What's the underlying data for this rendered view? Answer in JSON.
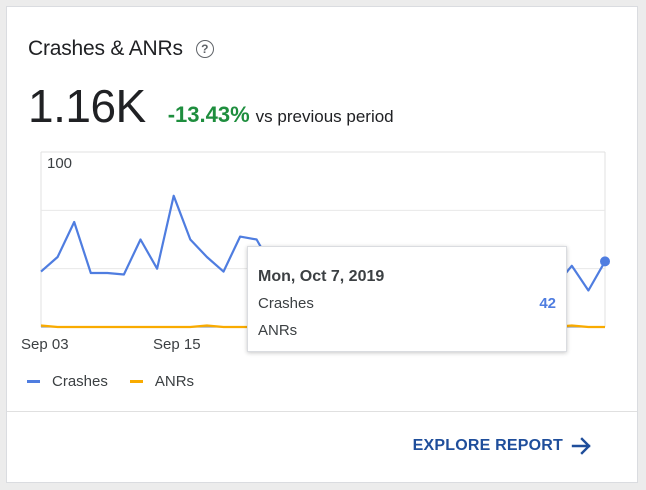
{
  "card": {
    "title": "Crashes & ANRs",
    "help_icon": "help-circle-icon",
    "value": "1.16K",
    "delta": "-13.43%",
    "delta_suffix": "vs previous period",
    "delta_color": "#1e8e3e"
  },
  "chart_data": {
    "type": "line",
    "y_tick_labels": [
      "100"
    ],
    "ylim": [
      0,
      120
    ],
    "x_tick_labels": [
      "Sep 03",
      "Sep 15"
    ],
    "grid": true,
    "series": [
      {
        "name": "Crashes",
        "color": "#4f7de0",
        "values": [
          38,
          48,
          72,
          37,
          37,
          36,
          60,
          40,
          90,
          60,
          48,
          38,
          62,
          60,
          40,
          30,
          30,
          30,
          30,
          30,
          28,
          40,
          30,
          28,
          30,
          30,
          40,
          30,
          42,
          40,
          30,
          28,
          42,
          25,
          45
        ]
      },
      {
        "name": "ANRs",
        "color": "#f9ab00",
        "values": [
          1,
          0,
          0,
          0,
          0,
          0,
          0,
          0,
          0,
          0,
          1,
          0,
          0,
          0,
          0,
          0,
          0,
          0,
          0,
          0,
          0,
          0,
          0,
          0,
          0,
          0,
          0,
          0,
          0,
          0,
          0,
          0,
          1,
          0,
          0
        ]
      }
    ]
  },
  "tooltip": {
    "date": "Mon, Oct 7, 2019",
    "crashes_label": "Crashes",
    "crashes_value": "42",
    "anrs_label": "ANRs"
  },
  "legend": [
    {
      "label": "Crashes",
      "color": "#4f7de0"
    },
    {
      "label": "ANRs",
      "color": "#f9ab00"
    }
  ],
  "footer": {
    "explore_label": "EXPLORE REPORT",
    "explore_icon": "arrow-right-icon"
  }
}
